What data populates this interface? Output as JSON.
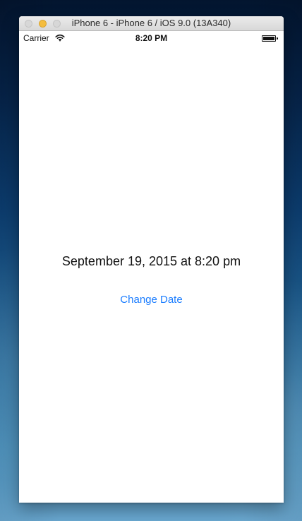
{
  "window": {
    "title": "iPhone 6 - iPhone 6 / iOS 9.0 (13A340)"
  },
  "status_bar": {
    "carrier": "Carrier",
    "time": "8:20 PM",
    "wifi_icon": "wifi-icon",
    "battery_icon": "battery-icon"
  },
  "content": {
    "date_text": "September 19, 2015 at 8:20 pm",
    "change_date_label": "Change Date"
  },
  "colors": {
    "link_blue": "#1b7dff",
    "titlebar_bg": "#e5e5e5",
    "screen_bg": "#ffffff",
    "wallpaper_top": "#03152f",
    "wallpaper_bottom": "#6aa9d2",
    "traffic_yellow": "#f4bd3f",
    "traffic_gray": "#d7d7d7"
  }
}
